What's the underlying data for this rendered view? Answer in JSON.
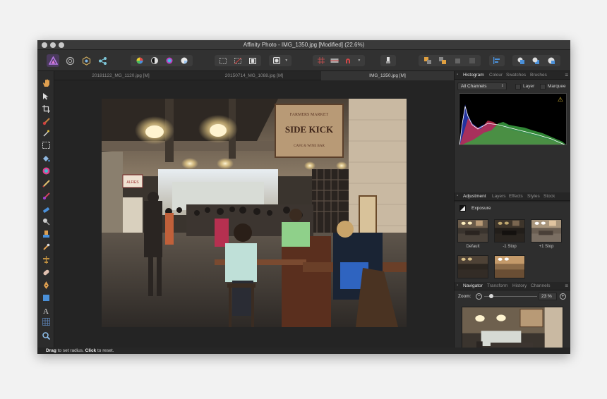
{
  "window": {
    "title": "Affinity Photo - IMG_1350.jpg [Modified] (22.6%)"
  },
  "toolbar": {
    "personas": [
      "photo-persona-icon",
      "liquify-persona-icon",
      "develop-persona-icon",
      "export-persona-icon"
    ]
  },
  "document_tabs": [
    {
      "label": "20181122_MG_1120.jpg [M]",
      "active": false
    },
    {
      "label": "20150714_MG_1088.jpg [M]",
      "active": false
    },
    {
      "label": "IMG_1350.jpg [M]",
      "active": true
    }
  ],
  "histogram_panel": {
    "tabs": [
      "Histogram",
      "Colour",
      "Swatches",
      "Brushes"
    ],
    "channel_select": "All Channels",
    "layer_label": "Layer",
    "marquee_label": "Marquee",
    "warning_icon": "warning-icon"
  },
  "adjustment_panel": {
    "tabs": [
      "Adjustment",
      "Layers",
      "Effects",
      "Styles",
      "Stock"
    ],
    "current_adjustment": "Exposure",
    "presets": [
      "Default",
      "-1 Stop",
      "+1 Stop",
      "",
      ""
    ]
  },
  "navigator_panel": {
    "tabs": [
      "Navigator",
      "Transform",
      "History",
      "Channels"
    ],
    "zoom_label": "Zoom:",
    "zoom_value": "23 %",
    "zoom_fraction": 0.1
  },
  "status_bar": {
    "drag_word": "Drag",
    "drag_text": " to set radius. ",
    "click_word": "Click",
    "click_text": " to reset."
  },
  "photo_sign": {
    "line1": "FARMERS MARKET",
    "line2": "SIDE KICK",
    "line3": "CAFE & WINE BAR",
    "small_sign": "ALFIES"
  },
  "colors": {
    "accent": "#4a90d9",
    "photo_persona": "#a45bd6",
    "warning": "#e6c23a"
  }
}
